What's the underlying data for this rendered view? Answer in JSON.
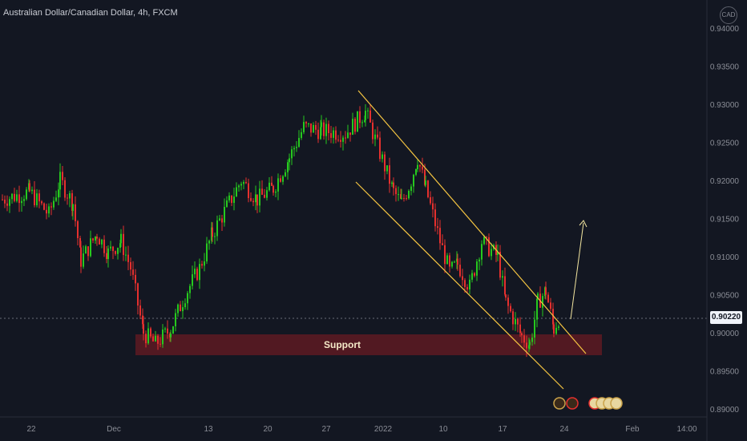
{
  "header": {
    "title": "Australian Dollar/Canadian Dollar, 4h, FXCM",
    "currency_badge": "CAD"
  },
  "price_axis": {
    "ticks": [
      "0.94000",
      "0.93500",
      "0.93000",
      "0.92500",
      "0.92000",
      "0.91500",
      "0.91000",
      "0.90500",
      "0.90000",
      "0.89500",
      "0.89000"
    ],
    "current_price": "0.90220"
  },
  "time_axis": {
    "ticks": [
      "22",
      "Dec",
      "13",
      "20",
      "27",
      "2022",
      "10",
      "17",
      "24",
      "Feb",
      "14:00"
    ]
  },
  "annotations": {
    "support_label": "Support"
  },
  "colors": {
    "background": "#131722",
    "bull": "#26c91e",
    "bear": "#e5302e",
    "channel": "#f5c542",
    "support_zone": "#5a1a22",
    "price_tag": "#f0f3fa"
  },
  "chart_data": {
    "type": "candlestick",
    "title": "Australian Dollar/Canadian Dollar, 4h, FXCM",
    "ylim": [
      0.89,
      0.94
    ],
    "close_path": [
      {
        "x": "Nov 19",
        "y": 0.9175
      },
      {
        "x": "Nov 22",
        "y": 0.9185
      },
      {
        "x": "Nov 24",
        "y": 0.9155
      },
      {
        "x": "Nov 25",
        "y": 0.92
      },
      {
        "x": "Nov 26",
        "y": 0.917
      },
      {
        "x": "Nov 29",
        "y": 0.9095
      },
      {
        "x": "Nov 30",
        "y": 0.913
      },
      {
        "x": "Dec 1",
        "y": 0.9105
      },
      {
        "x": "Dec 2",
        "y": 0.912
      },
      {
        "x": "Dec 3",
        "y": 0.9085
      },
      {
        "x": "Dec 6",
        "y": 0.9
      },
      {
        "x": "Dec 7",
        "y": 0.8985
      },
      {
        "x": "Dec 8",
        "y": 0.9005
      },
      {
        "x": "Dec 9",
        "y": 0.905
      },
      {
        "x": "Dec 10",
        "y": 0.9085
      },
      {
        "x": "Dec 13",
        "y": 0.913
      },
      {
        "x": "Dec 15",
        "y": 0.92
      },
      {
        "x": "Dec 16",
        "y": 0.9175
      },
      {
        "x": "Dec 20",
        "y": 0.919
      },
      {
        "x": "Dec 21",
        "y": 0.923
      },
      {
        "x": "Dec 22",
        "y": 0.927
      },
      {
        "x": "Dec 24",
        "y": 0.9265
      },
      {
        "x": "Dec 28",
        "y": 0.9262
      },
      {
        "x": "Dec 30",
        "y": 0.929
      },
      {
        "x": "Jan 3",
        "y": 0.9245
      },
      {
        "x": "Jan 4",
        "y": 0.9185
      },
      {
        "x": "Jan 5",
        "y": 0.917
      },
      {
        "x": "Jan 6",
        "y": 0.92
      },
      {
        "x": "Jan 7",
        "y": 0.923
      },
      {
        "x": "Jan 8",
        "y": 0.919
      },
      {
        "x": "Jan 10",
        "y": 0.912
      },
      {
        "x": "Jan 11",
        "y": 0.908
      },
      {
        "x": "Jan 12",
        "y": 0.909
      },
      {
        "x": "Jan 13",
        "y": 0.906
      },
      {
        "x": "Jan 14",
        "y": 0.912
      },
      {
        "x": "Jan 17",
        "y": 0.91
      },
      {
        "x": "Jan 18",
        "y": 0.904
      },
      {
        "x": "Jan 20",
        "y": 0.8995
      },
      {
        "x": "Jan 21",
        "y": 0.8985
      },
      {
        "x": "Jan 22",
        "y": 0.904
      },
      {
        "x": "Jan 23",
        "y": 0.9055
      },
      {
        "x": "Jan 24",
        "y": 0.9005
      },
      {
        "x": "Jan 25",
        "y": 0.9022
      }
    ],
    "descending_channel": {
      "upper": [
        {
          "x": "Dec 30",
          "y": 0.9318
        },
        {
          "x": "Jan 28",
          "y": 0.8975
        }
      ],
      "lower": [
        {
          "x": "Dec 27",
          "y": 0.9205
        },
        {
          "x": "Jan 27",
          "y": 0.8925
        }
      ]
    },
    "support_zone": {
      "from": "Dec 5",
      "to": "Jan 31",
      "y_low": 0.8973,
      "y_high": 0.8999,
      "label": "Support"
    },
    "projection_arrow": [
      {
        "x": "Jan 25",
        "y": 0.9035
      },
      {
        "x": "Jan 27",
        "y": 0.916
      }
    ],
    "last_price": 0.9022
  }
}
